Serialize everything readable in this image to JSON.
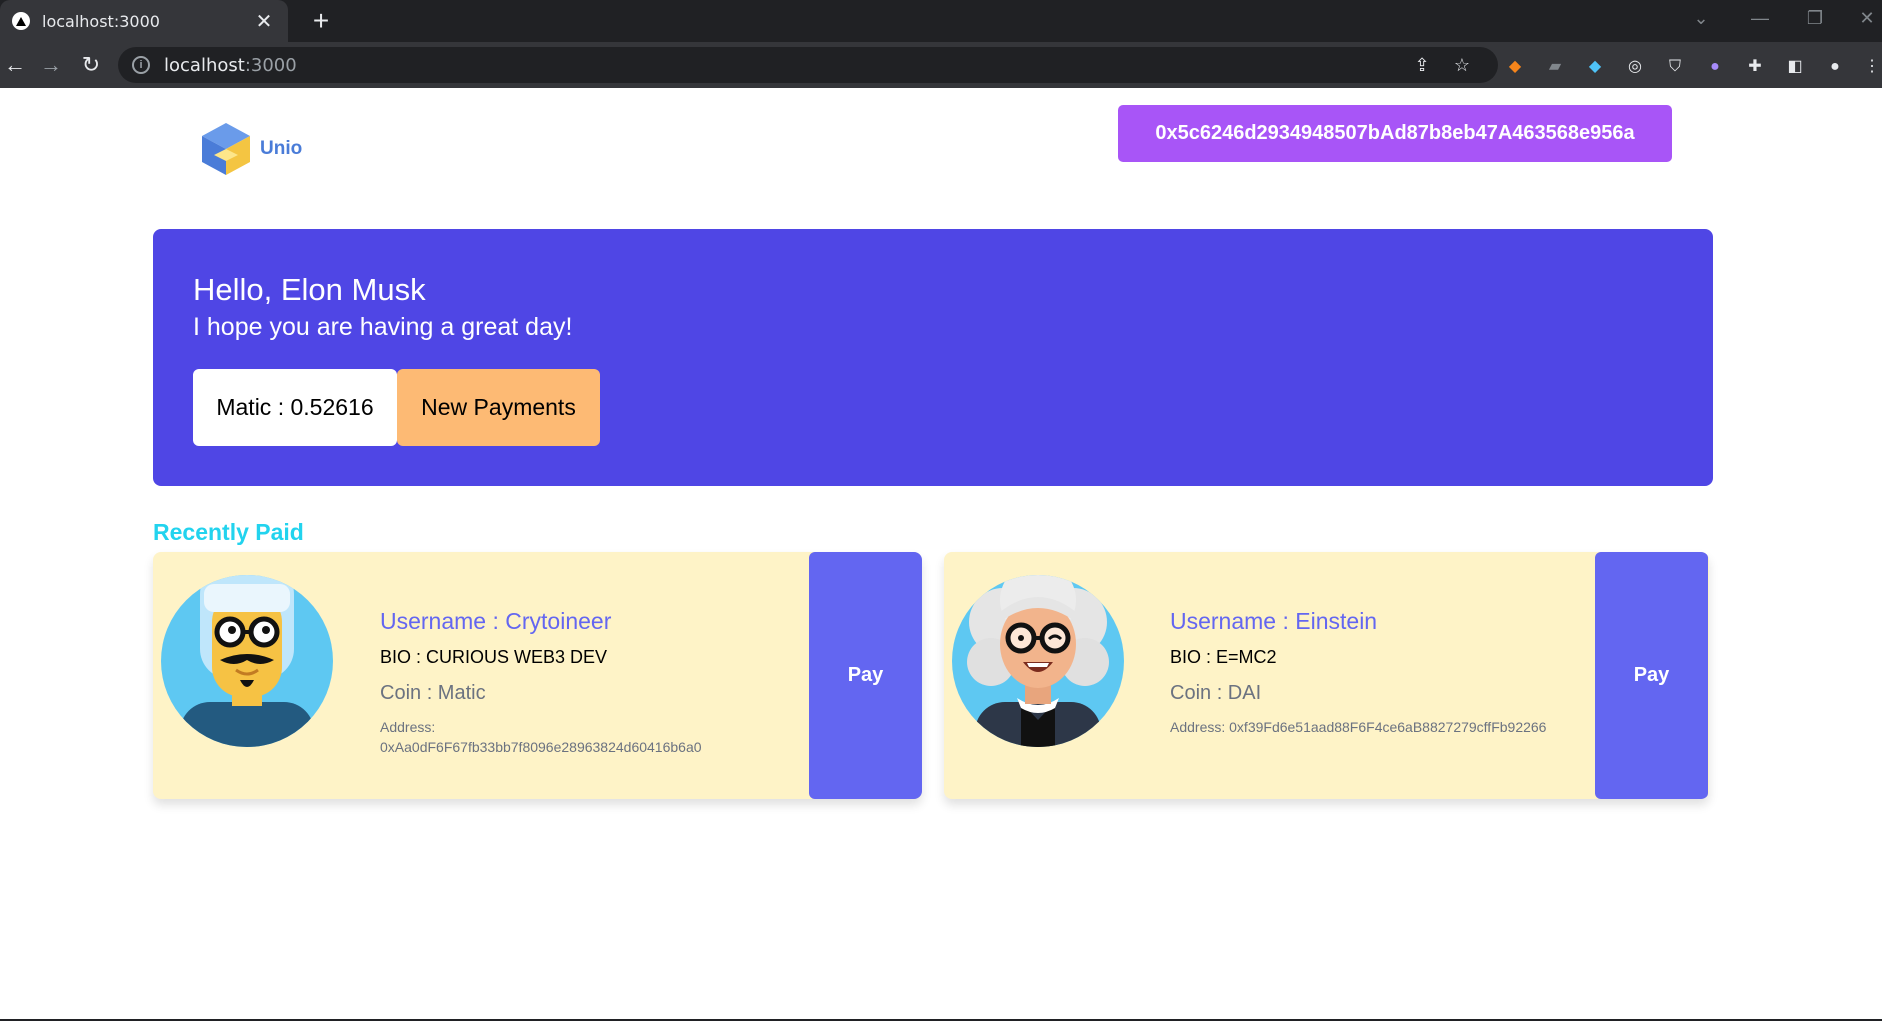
{
  "browser": {
    "tab_title": "localhost:3000",
    "tab_close": "✕",
    "new_tab": "+",
    "url_host": "localhost",
    "url_port": ":3000"
  },
  "header": {
    "logo_text": "Unio",
    "wallet_address": "0x5c6246d2934948507bAd87b8eb47A463568e956a"
  },
  "hero": {
    "greeting": "Hello, Elon Musk",
    "subtitle": "I hope you are having a great day!",
    "balance": "Matic : 0.52616",
    "new_payments_label": "New Payments"
  },
  "recent": {
    "title": "Recently Paid",
    "cards": [
      {
        "username": "Username : Crytoineer",
        "bio": "BIO : CURIOUS WEB3 DEV",
        "coin": "Coin : Matic",
        "address_label": "Address:",
        "address": "0xAa0dF6F67fb33bb7f8096e28963824d60416b6a0",
        "pay_label": "Pay"
      },
      {
        "username": "Username : Einstein",
        "bio": "BIO : E=MC2",
        "coin": "Coin : DAI",
        "address_full": "Address: 0xf39Fd6e51aad88F6F4ce6aB8827279cffFb92266",
        "pay_label": "Pay"
      }
    ]
  },
  "colors": {
    "hero_bg": "#4f46e5",
    "wallet_bg": "#a855f7",
    "new_payments_bg": "#fdba74",
    "recent_title": "#22d3ee",
    "card_bg": "#fef3c7",
    "pay_bg": "#6366f1"
  }
}
